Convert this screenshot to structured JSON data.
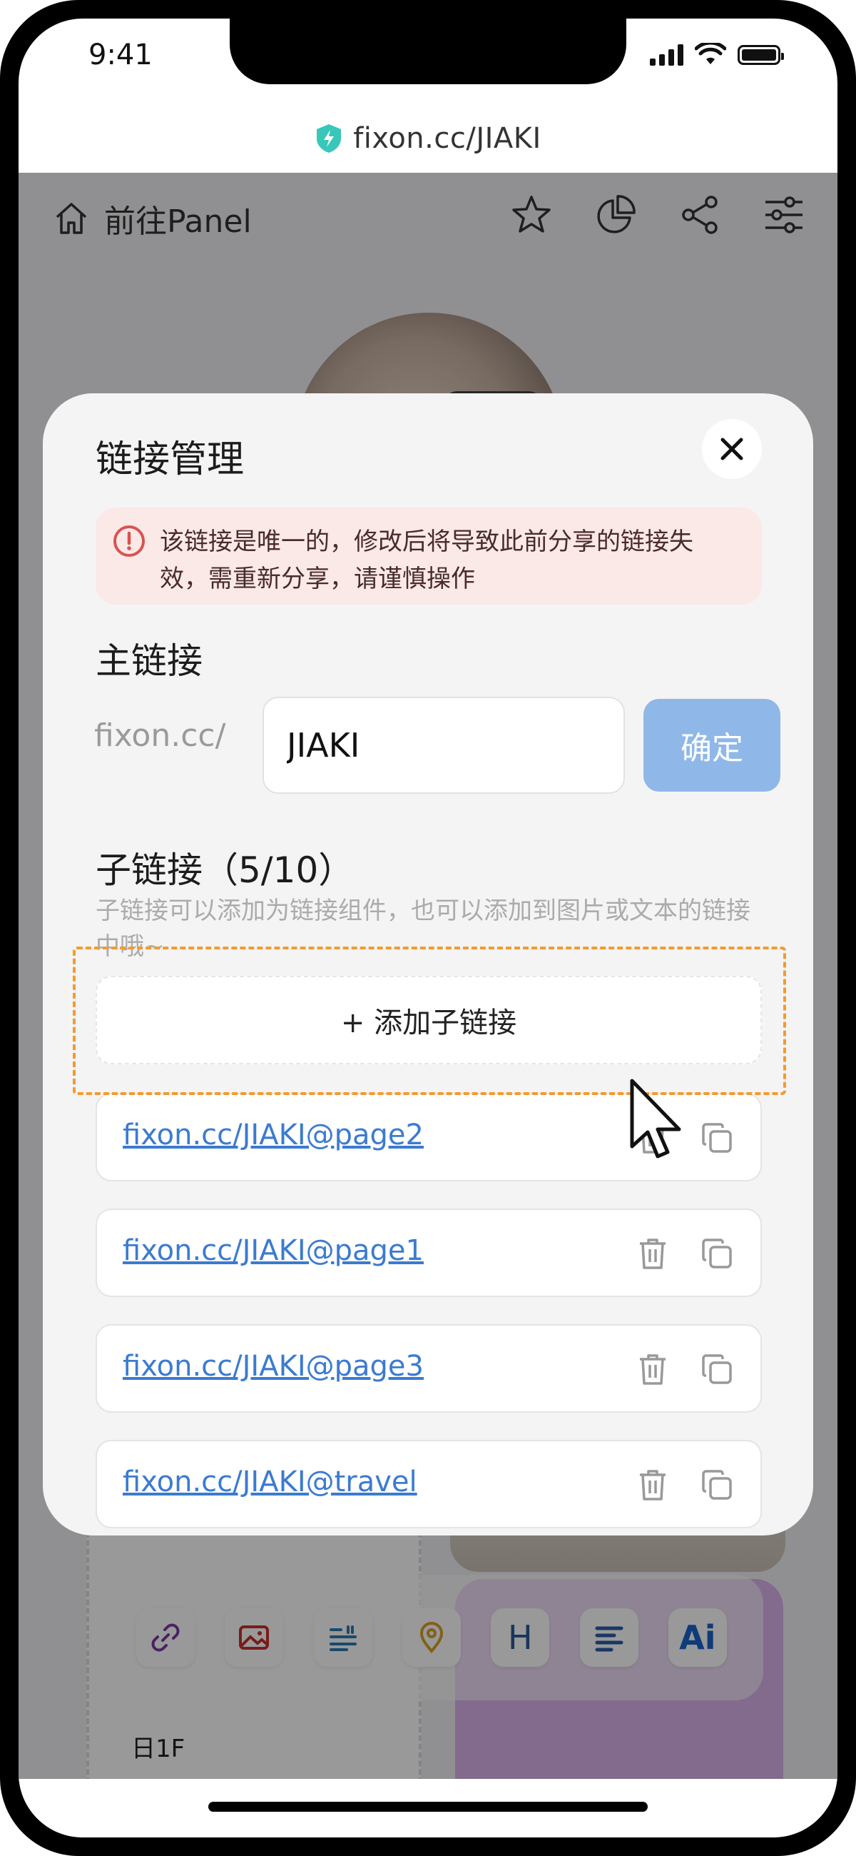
{
  "status_bar": {
    "time": "9:41"
  },
  "address_bar": {
    "url": "fixon.cc/JIAKI"
  },
  "page": {
    "home_label": "前往Panel",
    "header_icons": [
      "star-icon",
      "pie-chart-icon",
      "share-icon",
      "sliders-icon"
    ],
    "bg_text": "日1F",
    "toolbar": {
      "items": [
        "link-icon",
        "image-icon",
        "text-icon",
        "location-icon",
        "heading-icon",
        "paragraph-icon",
        "ai-icon"
      ],
      "heading_label": "H",
      "ai_label": "Ai"
    }
  },
  "modal": {
    "title": "链接管理",
    "warning": "该链接是唯一的，修改后将导致此前分享的链接失效，需重新分享，请谨慎操作",
    "main_link": {
      "label": "主链接",
      "prefix": "fixon.cc/",
      "value": "JIAKI",
      "confirm": "确定"
    },
    "sub_links": {
      "label": "子链接（5/10）",
      "hint": "子链接可以添加为链接组件，也可以添加到图片或文本的链接中哦~",
      "add_button": "+ 添加子链接",
      "items": [
        "fixon.cc/JIAKI@page2",
        "fixon.cc/JIAKI@page1",
        "fixon.cc/JIAKI@page3",
        "fixon.cc/JIAKI@travel"
      ]
    }
  },
  "colors": {
    "accent": "#3b7bd0",
    "confirm_button": "#8fb8e8",
    "warning_bg": "#fbe9e8",
    "warning_icon": "#d9534f",
    "highlight": "#f59a2e"
  }
}
